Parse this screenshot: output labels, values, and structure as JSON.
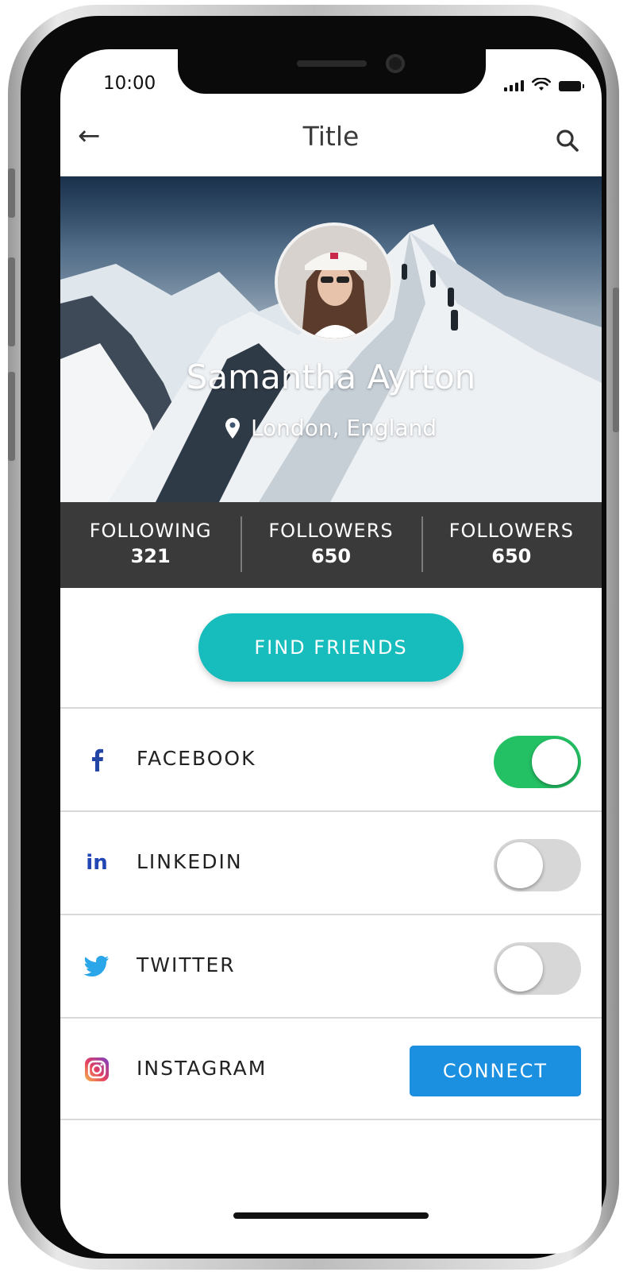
{
  "status_bar": {
    "time": "10:00"
  },
  "app_bar": {
    "title": "Title"
  },
  "profile": {
    "name": "Samantha Ayrton",
    "location": "London, England"
  },
  "stats": [
    {
      "label": "FOLLOWING",
      "value": "321"
    },
    {
      "label": "FOLLOWERS",
      "value": "650"
    },
    {
      "label": "FOLLOWERS",
      "value": "650"
    }
  ],
  "find_friends": {
    "label": "FIND FRIENDS"
  },
  "social": [
    {
      "label": "FACEBOOK",
      "control": "toggle",
      "on": true
    },
    {
      "label": "LINKEDIN",
      "control": "toggle",
      "on": false
    },
    {
      "label": "TWITTER",
      "control": "toggle",
      "on": false
    },
    {
      "label": "INSTAGRAM",
      "control": "button",
      "button_label": "CONNECT"
    }
  ],
  "colors": {
    "accent_teal": "#17bcbc",
    "toggle_on": "#24c064",
    "connect_blue": "#1b8fe0",
    "stats_bg": "#3a3a3a"
  }
}
